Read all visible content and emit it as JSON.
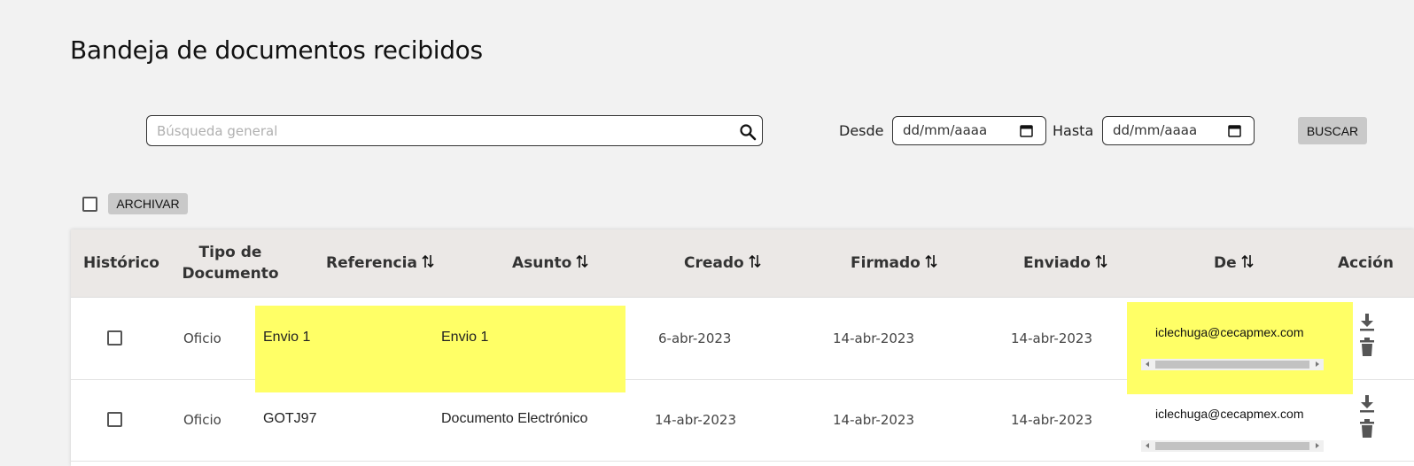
{
  "page": {
    "title": "Bandeja de documentos recibidos"
  },
  "search": {
    "placeholder": "Búsqueda general",
    "value": ""
  },
  "filters": {
    "desde_label": "Desde",
    "desde_value": "dd/mm/aaaa",
    "hasta_label": "Hasta",
    "hasta_value": "dd/mm/aaaa",
    "buscar_label": "BUSCAR"
  },
  "toolbar": {
    "archivar_label": "ARCHIVAR"
  },
  "table": {
    "headers": {
      "historico": "Histórico",
      "tipo_line1": "Tipo de",
      "tipo_line2": "Documento",
      "referencia": "Referencia",
      "asunto": "Asunto",
      "creado": "Creado",
      "firmado": "Firmado",
      "enviado": "Enviado",
      "de": "De",
      "accion": "Acción"
    },
    "rows": [
      {
        "tipo": "Oficio",
        "referencia": "Envio 1",
        "asunto": "Envio 1",
        "creado": "6-abr-2023",
        "firmado": "14-abr-2023",
        "enviado": "14-abr-2023",
        "de": "iclechuga@cecapmex.com",
        "highlighted": true
      },
      {
        "tipo": "Oficio",
        "referencia": "GOTJ97",
        "asunto": "Documento Electrónico",
        "creado": "14-abr-2023",
        "firmado": "14-abr-2023",
        "enviado": "14-abr-2023",
        "de": "iclechuga@cecapmex.com",
        "highlighted": false
      }
    ]
  },
  "colors": {
    "highlight": "#ffff66",
    "header_bg": "#ebe8e6",
    "button_bg": "#c9c9c9",
    "page_bg": "#f2f2f2"
  },
  "icons": [
    "search-icon",
    "calendar-icon",
    "sort-icon",
    "download-icon",
    "trash-icon"
  ]
}
